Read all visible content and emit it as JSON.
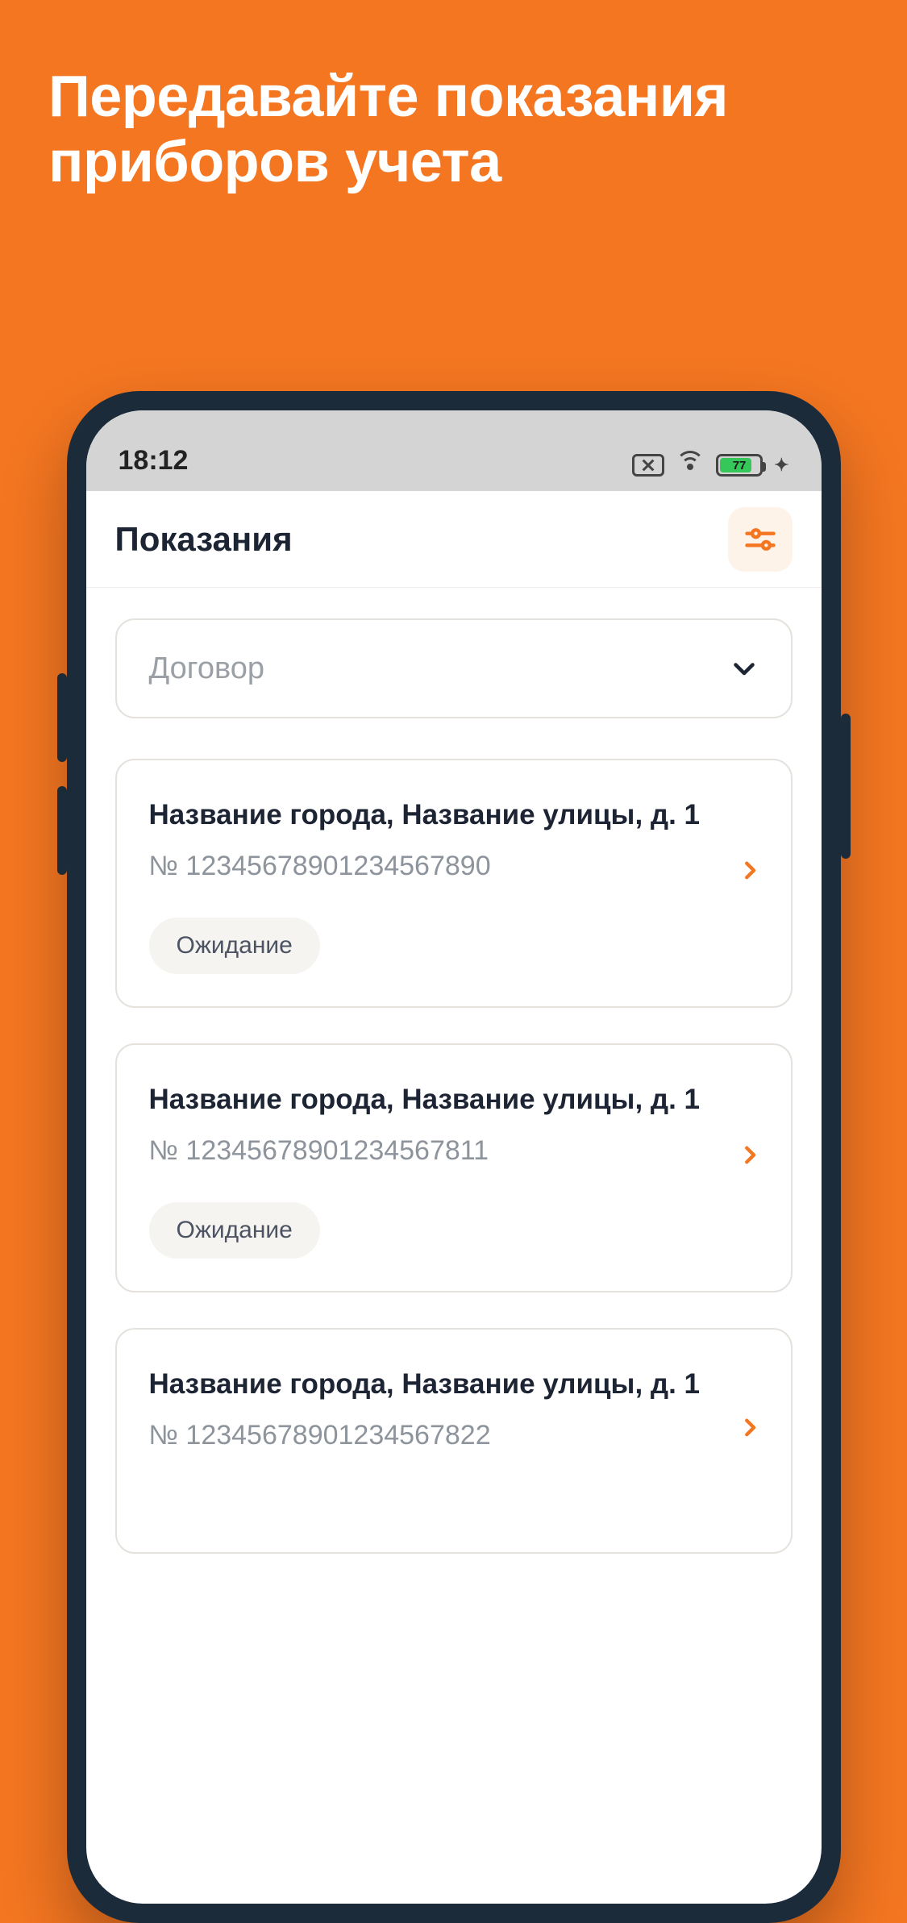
{
  "promo": {
    "title": "Передавайте показания приборов учета"
  },
  "status": {
    "time": "18:12",
    "battery_text": "77"
  },
  "header": {
    "title": "Показания"
  },
  "dropdown": {
    "label": "Договор"
  },
  "cards": [
    {
      "title": "Название города, Название улицы, д. 1",
      "number": "№ 12345678901234567890",
      "status": "Ожидание"
    },
    {
      "title": "Название города, Название улицы, д. 1",
      "number": "№ 12345678901234567811",
      "status": "Ожидание"
    },
    {
      "title": "Название города, Название улицы, д. 1",
      "number": "№ 12345678901234567822",
      "status": ""
    }
  ]
}
